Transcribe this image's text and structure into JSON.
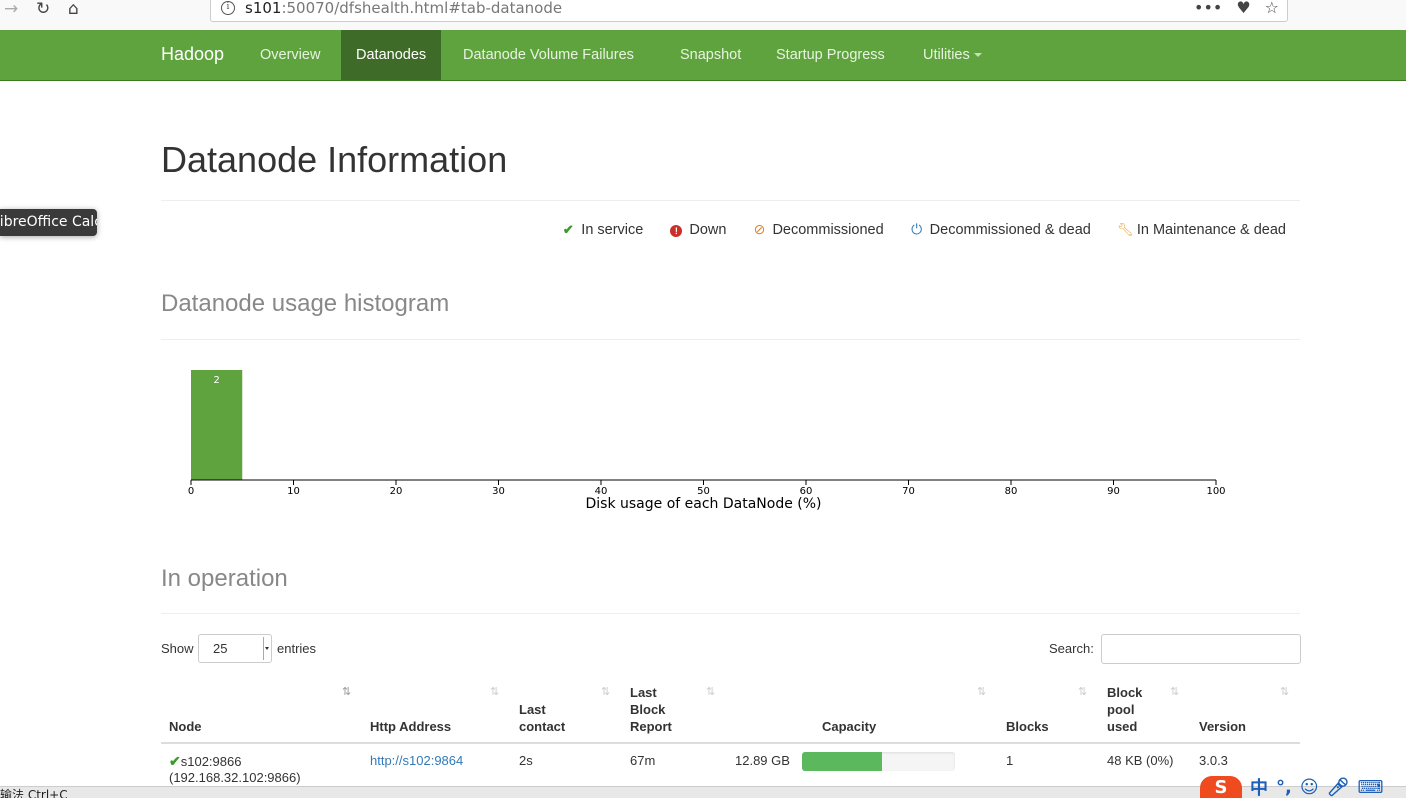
{
  "browser": {
    "back": "←",
    "forward": "→",
    "reload": "↻",
    "home": "⌂",
    "url_host": "s101",
    "url_rest": ":50070/dfshealth.html#tab-datanode",
    "actions": [
      "•••",
      "♥",
      "☆"
    ]
  },
  "navbar": {
    "brand": "Hadoop",
    "items": [
      {
        "label": "Overview",
        "active": false
      },
      {
        "label": "Datanodes",
        "active": true
      },
      {
        "label": "Datanode Volume Failures",
        "active": false
      },
      {
        "label": "Snapshot",
        "active": false
      },
      {
        "label": "Startup Progress",
        "active": false
      },
      {
        "label": "Utilities",
        "active": false,
        "dropdown": true
      }
    ]
  },
  "tooltip": "LibreOffice Calc",
  "page": {
    "title": "Datanode Information"
  },
  "legend": [
    {
      "icon": "check-icon",
      "label": "In service",
      "color": "#3c9a2c"
    },
    {
      "icon": "exclamation-circle-icon",
      "label": "Down",
      "color": "#c9302c"
    },
    {
      "icon": "ban-icon",
      "label": "Decommissioned",
      "color": "#d9822b"
    },
    {
      "icon": "power-icon",
      "label": "Decommissioned & dead",
      "color": "#337ab7"
    },
    {
      "icon": "wrench-icon",
      "label": "In Maintenance & dead",
      "color": "#e8a33d"
    }
  ],
  "histogram": {
    "title": "Datanode usage histogram"
  },
  "chart_data": {
    "type": "bar",
    "title": "Datanode usage histogram",
    "xlabel": "Disk usage of each DataNode (%)",
    "ylabel": "",
    "xlim": [
      0,
      100
    ],
    "xticks": [
      0,
      10,
      20,
      30,
      40,
      50,
      60,
      70,
      80,
      90,
      100
    ],
    "bins": [
      {
        "x0": 0,
        "x1": 5,
        "count": 2
      }
    ],
    "bar_color": "#5fa33e"
  },
  "operation": {
    "title": "In operation",
    "show_label": "Show",
    "page_size": "25",
    "entries_label": "entries",
    "search_label": "Search:",
    "search_value": "",
    "columns": [
      "Node",
      "Http Address",
      "Last contact",
      "Last Block Report",
      "Capacity",
      "Blocks",
      "Block pool used",
      "Version"
    ],
    "rows": [
      {
        "node": "s102:9866",
        "node_ip": "(192.168.32.102:9866)",
        "http": "http://s102:9864",
        "last_contact": "2s",
        "last_block_report": "67m",
        "capacity": "12.89 GB",
        "capacity_used_pct": 52,
        "blocks": "1",
        "block_pool_used": "48 KB (0%)",
        "version": "3.0.3"
      }
    ]
  },
  "taskbar": {
    "text": "输法 Ctrl+C"
  }
}
